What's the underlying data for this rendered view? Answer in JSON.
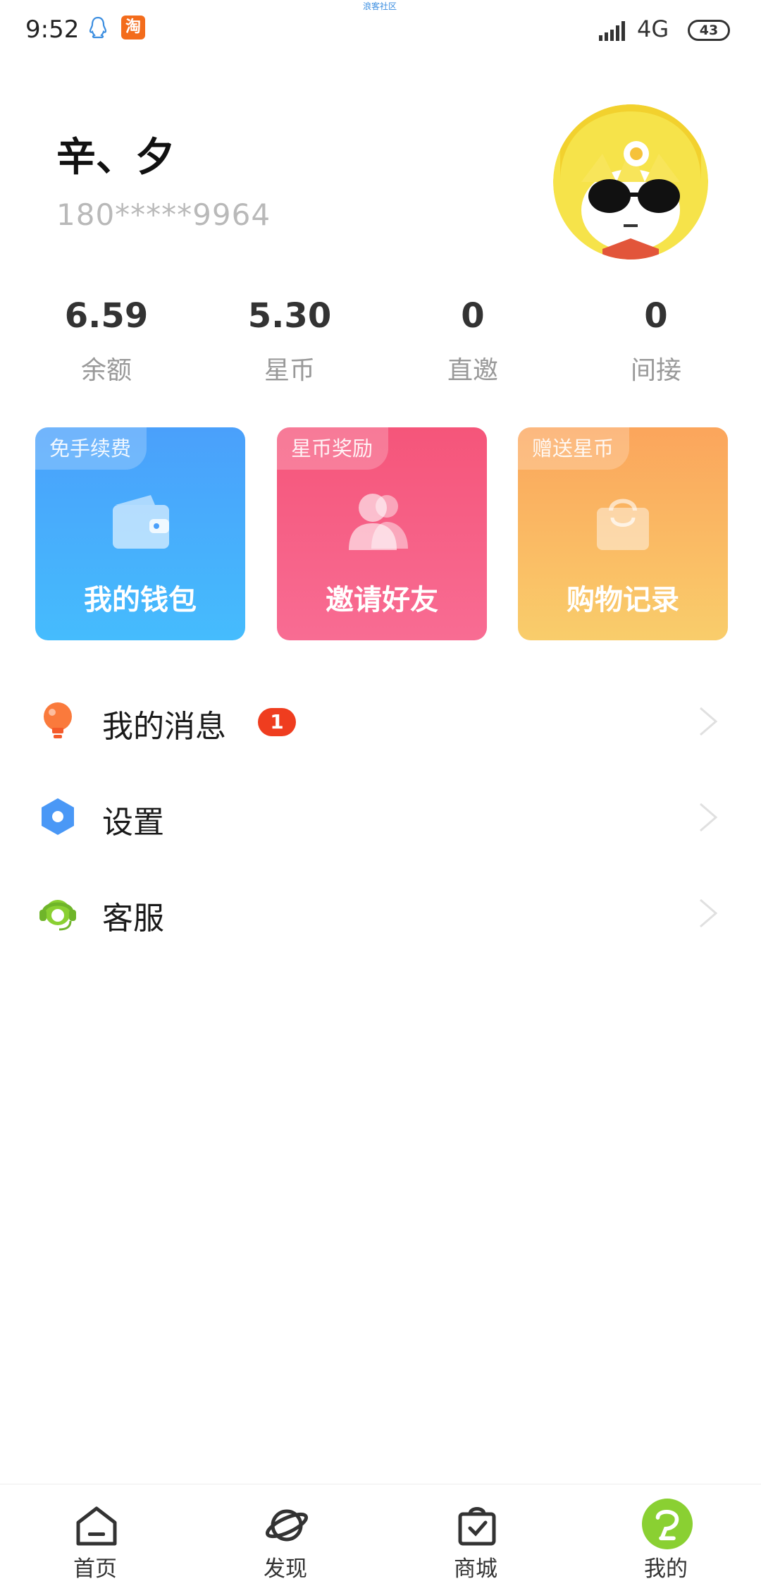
{
  "status_bar": {
    "time": "9:52",
    "center_text": "浪客社区",
    "network": "4G",
    "battery": "43",
    "icons": [
      "qq-icon",
      "taobao-icon",
      "signal-icon"
    ],
    "taobao_char": "淘"
  },
  "profile": {
    "username": "辛、夕",
    "phone": "180*****9964"
  },
  "stats": [
    {
      "value": "6.59",
      "label": "余额"
    },
    {
      "value": "5.30",
      "label": "星币"
    },
    {
      "value": "0",
      "label": "直邀"
    },
    {
      "value": "0",
      "label": "间接"
    }
  ],
  "cards": [
    {
      "tag": "免手续费",
      "title": "我的钱包",
      "icon": "wallet-icon",
      "color": "#4aa0fb"
    },
    {
      "tag": "星币奖励",
      "title": "邀请好友",
      "icon": "users-icon",
      "color": "#f5557a"
    },
    {
      "tag": "赠送星币",
      "title": "购物记录",
      "icon": "shopping-bag-icon",
      "color": "#fba55c"
    }
  ],
  "menu": [
    {
      "label": "我的消息",
      "badge": "1",
      "icon": "bulb-icon"
    },
    {
      "label": "设置",
      "icon": "hexagon-settings-icon"
    },
    {
      "label": "客服",
      "icon": "headset-icon"
    }
  ],
  "bottom_nav": [
    {
      "label": "首页",
      "icon": "home-icon"
    },
    {
      "label": "发现",
      "icon": "planet-icon"
    },
    {
      "label": "商城",
      "icon": "bag-check-icon"
    },
    {
      "label": "我的",
      "icon": "profile-active-icon",
      "active": true
    }
  ],
  "colors": {
    "accent_green": "#8ad032",
    "badge_red": "#ef3d1f",
    "muted_text": "#999999"
  }
}
